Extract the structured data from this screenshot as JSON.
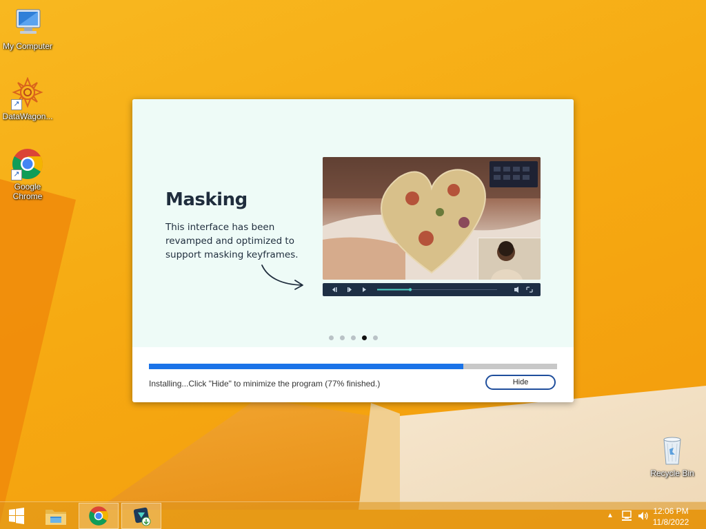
{
  "desktop": {
    "icons": [
      {
        "label": "My Computer"
      },
      {
        "label": "DataWagon..."
      },
      {
        "label": "Google Chrome"
      },
      {
        "label": "Recycle Bin"
      }
    ]
  },
  "installer": {
    "slide_title": "Masking",
    "slide_description": "This interface has been revamped and optimized to support masking keyframes.",
    "slide_count": 5,
    "active_slide_index": 3,
    "progress_percent": 77,
    "status_text": "Installing...Click \"Hide\" to minimize the program (77% finished.)",
    "hide_label": "Hide",
    "accent_color": "#1a73e8"
  },
  "taskbar": {
    "items": [
      {
        "icon": "windows-start-icon"
      },
      {
        "icon": "file-explorer-icon"
      },
      {
        "icon": "chrome-icon"
      },
      {
        "icon": "installer-app-icon"
      }
    ],
    "clock": {
      "time": "12:06 PM",
      "date": "11/8/2022"
    }
  }
}
